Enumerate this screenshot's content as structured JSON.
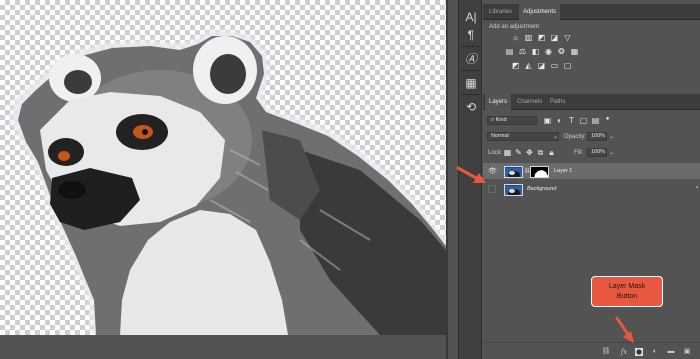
{
  "colors": {
    "accent_arrow": "#e9573f",
    "panel_bg": "#535353",
    "tab_bg": "#3c3c3c",
    "selected_layer": "#6b6b6b"
  },
  "top_panel": {
    "tabs": [
      "Libraries",
      "Adjustments"
    ],
    "active_tab": "Adjustments",
    "add_adjustment_label": "Add an adjustment"
  },
  "dock": {
    "icons": [
      "character-icon",
      "paragraph-icon",
      "glyphs-icon",
      "swatches-icon",
      "history-icon"
    ]
  },
  "layers_panel": {
    "tabs": [
      "Layers",
      "Channels",
      "Paths"
    ],
    "active_tab": "Layers",
    "filter_kind": "Kind",
    "blend_mode": "Normal",
    "opacity_label": "Opacity:",
    "opacity_value": "100%",
    "lock_label": "Lock:",
    "fill_label": "Fill:",
    "fill_value": "100%",
    "layers": [
      {
        "name": "Layer 1",
        "selected": true,
        "visible": true
      },
      {
        "name": "Background",
        "selected": false,
        "visible": false
      }
    ]
  },
  "callout": {
    "line1": "Layer Mask",
    "line2": "Button"
  },
  "bottom_icons": [
    "link-icon",
    "fx-icon",
    "layer-mask-icon",
    "adjustment-layer-icon",
    "group-folder-icon",
    "new-layer-icon"
  ]
}
